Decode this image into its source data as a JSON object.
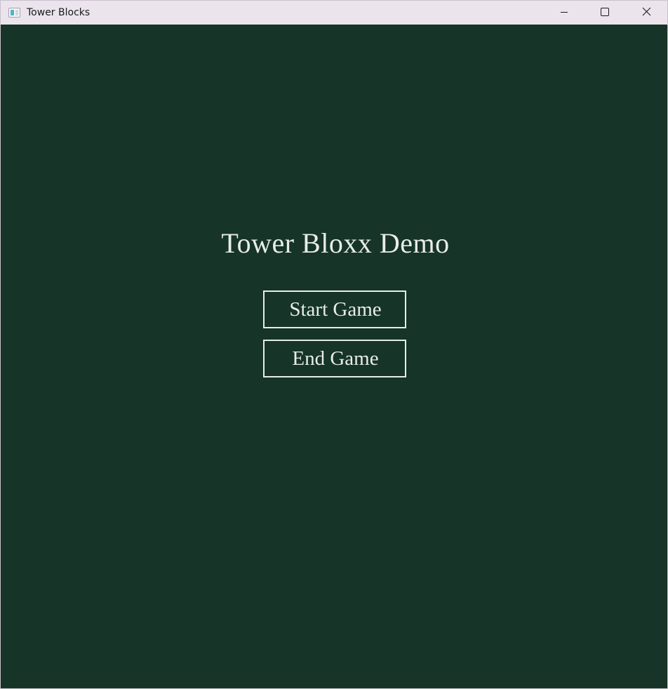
{
  "window": {
    "title": "Tower Blocks",
    "icon": "app-icon",
    "controls": {
      "minimize_icon": "minimize-icon",
      "maximize_icon": "maximize-icon",
      "close_icon": "close-icon"
    }
  },
  "menu": {
    "title": "Tower Bloxx Demo",
    "start_label": "Start Game",
    "end_label": "End Game"
  },
  "colors": {
    "background": "#163428",
    "foreground": "#e8ece9",
    "titlebar": "#ebe4ed"
  }
}
